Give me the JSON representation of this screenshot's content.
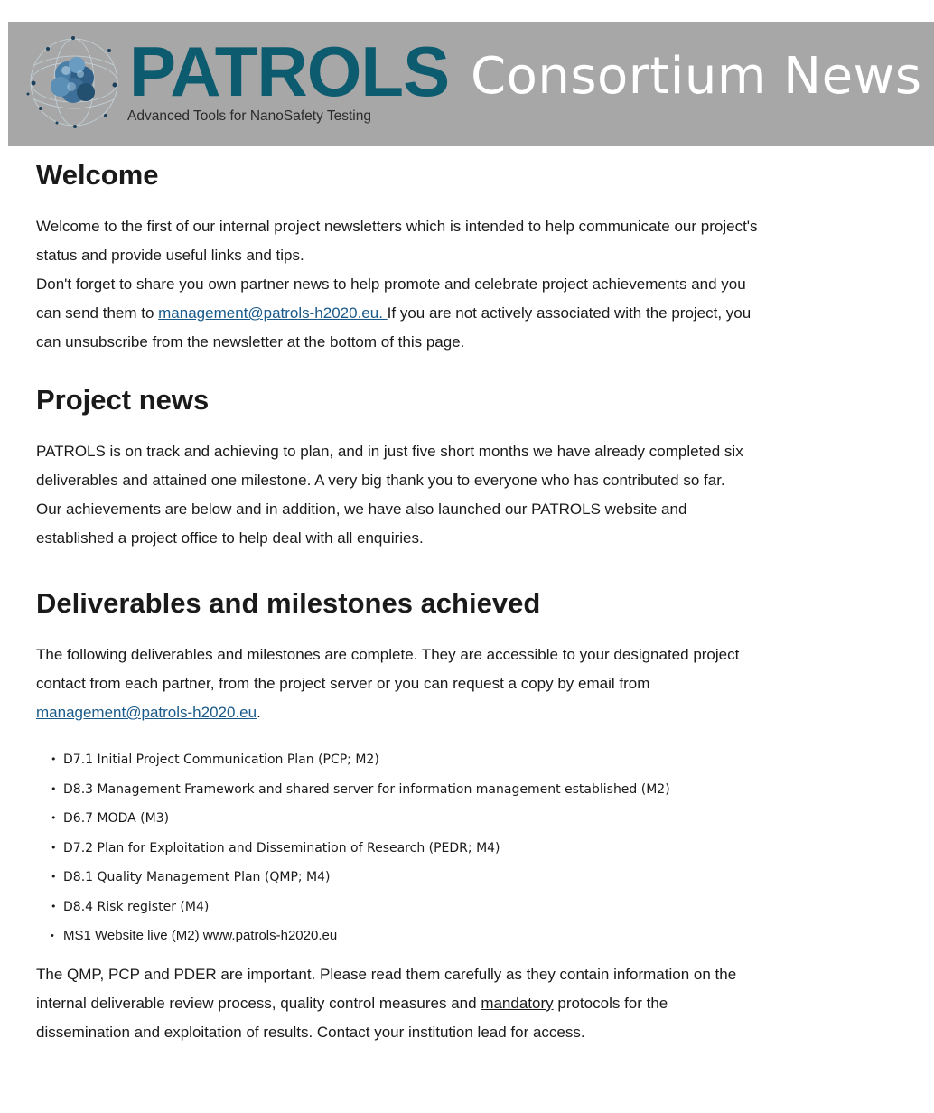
{
  "banner": {
    "brand": "PATROLS",
    "tagline": "Advanced Tools for NanoSafety Testing",
    "title": "Consortium News",
    "logo_icon": "nanoparticle-cluster-icon",
    "brand_color": "#0d5b6e",
    "background_color": "#a7a7a7"
  },
  "welcome": {
    "heading": "Welcome",
    "line1": "Welcome to the first of our internal project newsletters which is intended to help communicate our project's",
    "line2": "status and provide useful links and tips.",
    "line3": "Don't forget to share you own partner news to help promote and celebrate project achievements and you",
    "line4_before": "can send them to ",
    "line4_link": "management@patrols-h2020.eu. ",
    "line4_after": " If you are not actively associated with the project, you",
    "line5": "can unsubscribe from the newsletter at the bottom of this page."
  },
  "project_news": {
    "heading": "Project news",
    "line1": "PATROLS is on track and achieving to plan, and in just five short months we have already completed six",
    "line2": "deliverables and attained one milestone. A very big thank you to everyone who has contributed so far.",
    "line3": "Our achievements are below and in addition, we have also launched our PATROLS website and",
    "line4": "established a project office to help deal with all enquiries."
  },
  "deliverables": {
    "heading": "Deliverables and milestones achieved",
    "line1": "The following deliverables and milestones are complete.  They are accessible to your designated project",
    "line2": "contact from each partner, from the project server or you can request a copy by email from",
    "link": "management@patrols-h2020.eu",
    "link_after": ".",
    "bullet": "•",
    "items": [
      "D7.1 Initial Project Communication Plan (PCP; M2)",
      "D8.3 Management Framework and shared server for information management established (M2)",
      "D6.7 MODA (M3)",
      "D7.2 Plan for Exploitation and Dissemination of Research (PEDR; M4)",
      "D8.1 Quality Management Plan (QMP; M4)",
      "D8.4 Risk register (M4)",
      "MS1 Website live (M2) www.patrols-h2020.eu"
    ]
  },
  "closing": {
    "line1": "The QMP, PCP and PDER are important.  Please read them carefully as they contain information on the",
    "line2_before": "internal deliverable review process, quality control measures and ",
    "line2_emph": "mandatory",
    "line2_after": " protocols for the",
    "line3": "dissemination and exploitation of results.  Contact your institution lead for access."
  }
}
